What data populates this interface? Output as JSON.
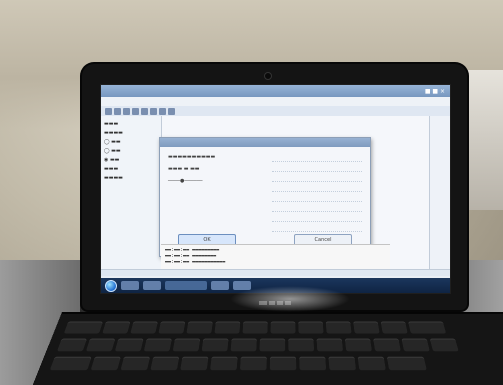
{
  "scene": {
    "description_icon": "photo-of-laptop-screen",
    "colors": {
      "carpet": "#c7c0ae",
      "laptop": "#141414",
      "screen": "#e9eef5",
      "taskbar": "#153057",
      "accent": "#7797bf"
    }
  },
  "dialog": {
    "ok_label": "OK",
    "cancel_label": "Cancel"
  }
}
